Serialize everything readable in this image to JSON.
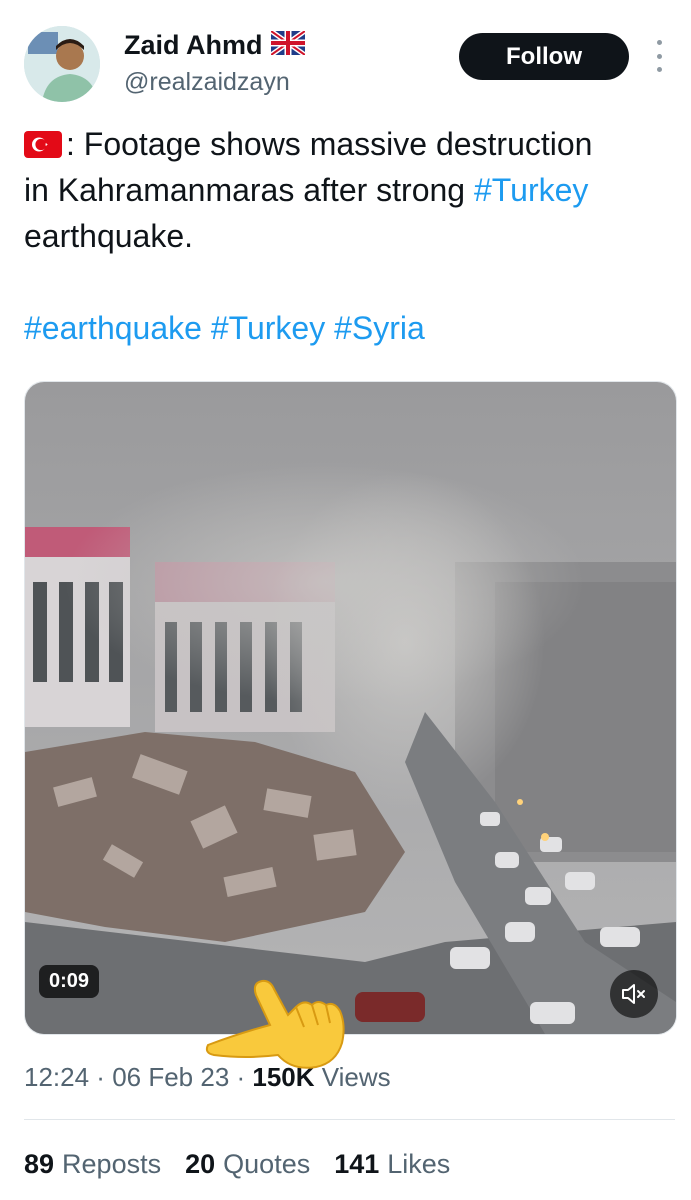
{
  "author": {
    "name": "Zaid Ahmd",
    "handle": "@realzaidzayn",
    "flag_icon": "uk-flag-icon"
  },
  "follow_label": "Follow",
  "tweet": {
    "line1_text": ": Footage shows massive destruction",
    "line2_text": "in Kahramanmaras after strong ",
    "line2_tag": "#Turkey",
    "line3_text": "earthquake.",
    "tags": [
      "#earthquake",
      "#Turkey",
      "#Syria"
    ]
  },
  "video": {
    "duration": "0:09"
  },
  "meta": {
    "time": "12:24",
    "sep": " · ",
    "date": "06 Feb 23",
    "views_count": "150K",
    "views_label": "Views"
  },
  "stats": {
    "reposts_count": "89",
    "reposts_label": "Reposts",
    "quotes_count": "20",
    "quotes_label": "Quotes",
    "likes_count": "141",
    "likes_label": "Likes"
  },
  "colors": {
    "link": "#1d9bf0",
    "muted": "#536471",
    "text": "#0f1419",
    "button_bg": "#0f1419"
  }
}
